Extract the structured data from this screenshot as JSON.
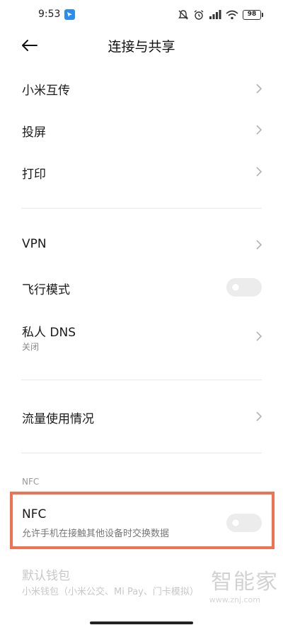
{
  "status_bar": {
    "time": "9:53",
    "battery": "98",
    "icons": [
      "app-notification-icon",
      "mute-icon",
      "alarm-icon",
      "signal-icon",
      "wifi-icon",
      "battery-icon"
    ]
  },
  "header": {
    "title": "连接与共享"
  },
  "items": {
    "mi_share": "小米互传",
    "cast": "投屏",
    "print": "打印",
    "vpn": "VPN",
    "airplane": "飞行模式",
    "private_dns": "私人 DNS",
    "private_dns_status": "关闭",
    "data_usage": "流量使用情况",
    "nfc_section": "NFC",
    "nfc": "NFC",
    "nfc_desc": "允许手机在接触其他设备时交换数据",
    "wallet": "默认钱包",
    "wallet_desc": "小米钱包（小米公交、Mi Pay、门卡模拟）"
  },
  "toggles": {
    "airplane_on": false,
    "nfc_on": false
  },
  "colors": {
    "highlight_border": "#ef7350",
    "toggle_off": "#ececec"
  },
  "watermark": {
    "main": "智能家",
    "sub": "www.znj.com"
  }
}
